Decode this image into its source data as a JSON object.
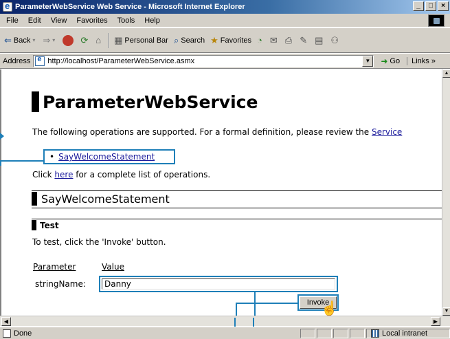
{
  "window": {
    "title": "ParameterWebService Web Service - Microsoft Internet Explorer",
    "controls": [
      "_",
      "□",
      "×"
    ]
  },
  "menubar": {
    "items": [
      "File",
      "Edit",
      "View",
      "Favorites",
      "Tools",
      "Help"
    ]
  },
  "toolbar": {
    "back_label": "Back",
    "personal_bar_label": "Personal Bar",
    "search_label": "Search",
    "favorites_label": "Favorites"
  },
  "address": {
    "label": "Address",
    "url": "http://localhost/ParameterWebService.asmx",
    "go_label": "Go",
    "links_label": "Links"
  },
  "page": {
    "title": "ParameterWebService",
    "intro": "The following operations are supported. For a formal definition, please review the ",
    "intro_link": "Service",
    "operation": "SayWelcomeStatement",
    "click_prefix": "Click ",
    "click_link": "here",
    "click_suffix": " for a complete list of operations.",
    "section_title": "SayWelcomeStatement",
    "test_title": "Test",
    "test_instruction": "To test, click the 'Invoke' button.",
    "param_header": "Parameter",
    "value_header": "Value",
    "param_name": "stringName:",
    "param_value": "Danny",
    "invoke_label": "Invoke"
  },
  "statusbar": {
    "status_text": "Done",
    "zone_text": "Local intranet"
  },
  "colors": {
    "callout": "#1e7fb8",
    "link": "#1a1a9b",
    "chrome": "#d4d0c8"
  }
}
